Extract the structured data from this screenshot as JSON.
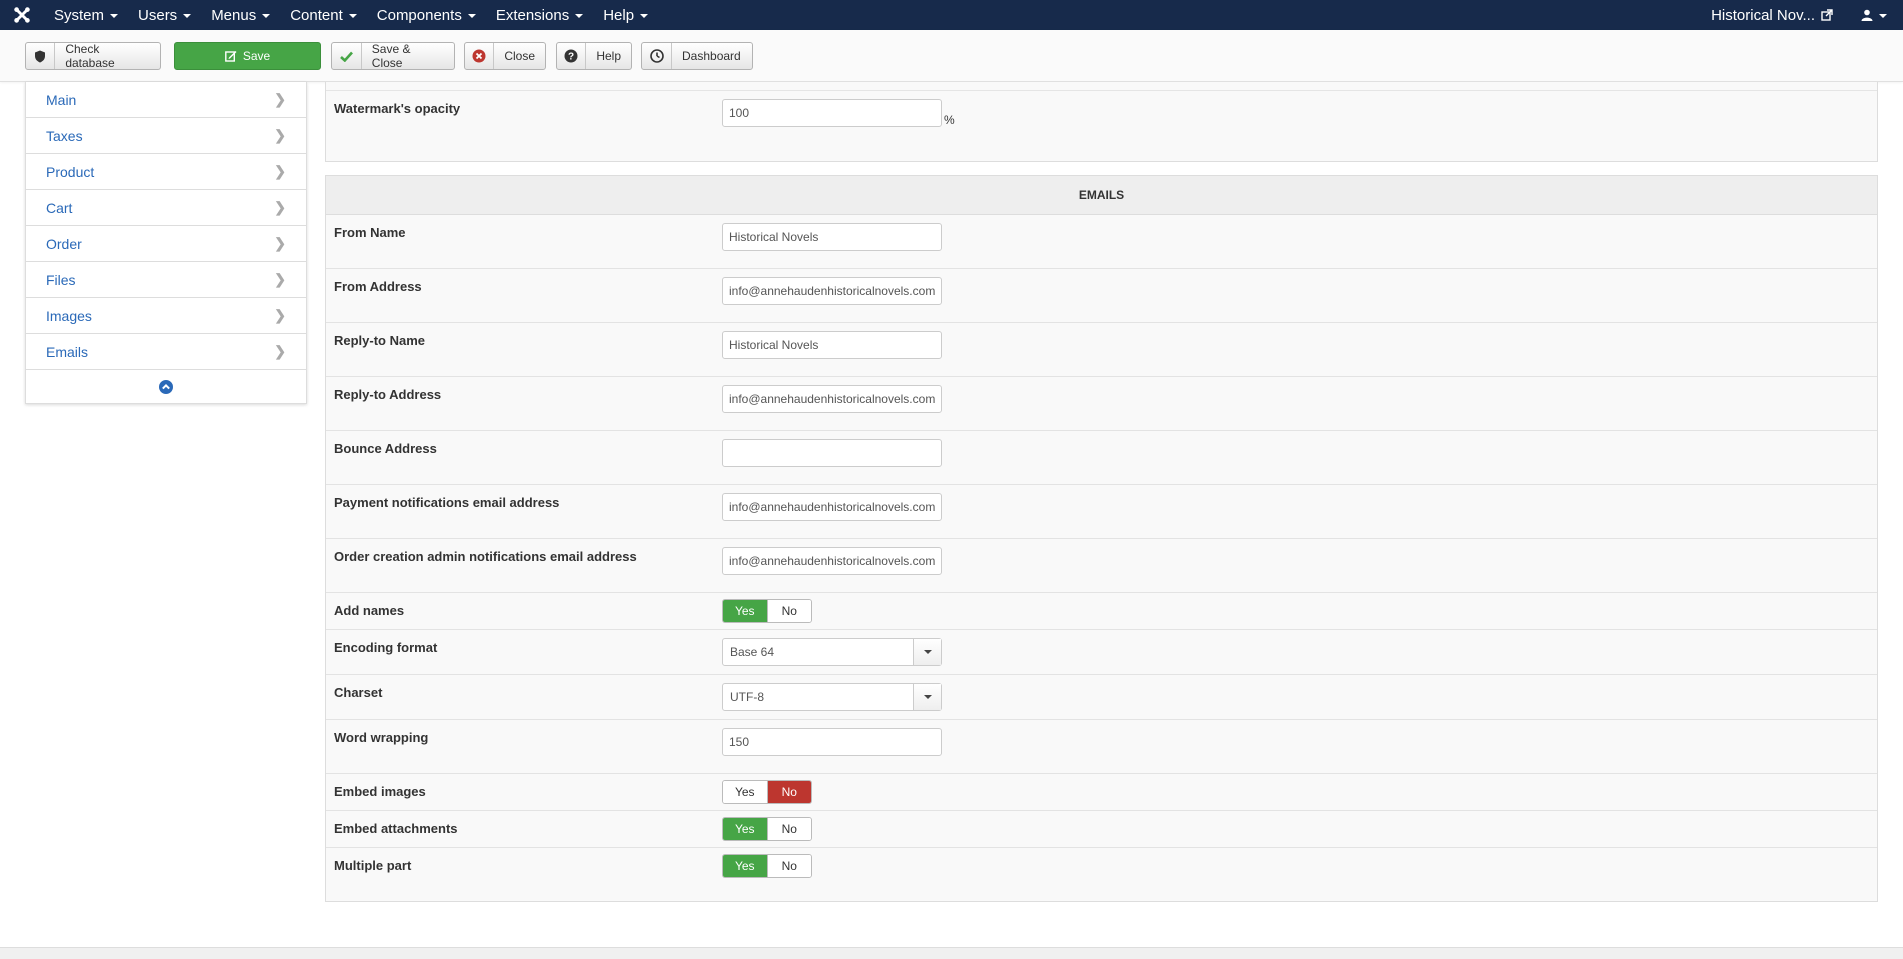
{
  "navbar": {
    "logo_icon": "joomla-logo-icon",
    "menus": [
      "System",
      "Users",
      "Menus",
      "Content",
      "Components",
      "Extensions",
      "Help"
    ],
    "site_name": "Historical Nov...",
    "site_icon": "external-link-icon",
    "user_icon": "user-icon"
  },
  "toolbar": {
    "check_database": "Check database",
    "save": "Save",
    "save_close": "Save & Close",
    "close": "Close",
    "help": "Help",
    "dashboard": "Dashboard"
  },
  "sidebar": {
    "items": [
      "Main",
      "Taxes",
      "Product",
      "Cart",
      "Order",
      "Files",
      "Images",
      "Emails"
    ],
    "collapse_icon": "chevron-up-circle-icon"
  },
  "watermark": {
    "label": "Watermark's opacity",
    "value": "100",
    "unit": "%"
  },
  "emails": {
    "heading": "EMAILS",
    "from_name": {
      "label": "From Name",
      "value": "Historical Novels"
    },
    "from_address": {
      "label": "From Address",
      "value": "info@annehaudenhistoricalnovels.com"
    },
    "reply_to_name": {
      "label": "Reply-to Name",
      "value": "Historical Novels"
    },
    "reply_to_address": {
      "label": "Reply-to Address",
      "value": "info@annehaudenhistoricalnovels.com"
    },
    "bounce_address": {
      "label": "Bounce Address",
      "value": ""
    },
    "payment_notifications": {
      "label": "Payment notifications email address",
      "value": "info@annehaudenhistoricalnovels.com"
    },
    "order_admin_notifications": {
      "label": "Order creation admin notifications email address",
      "value": "info@annehaudenhistoricalnovels.com"
    },
    "add_names": {
      "label": "Add names",
      "yes": "Yes",
      "no": "No",
      "selected": "Yes"
    },
    "encoding_format": {
      "label": "Encoding format",
      "value": "Base 64"
    },
    "charset": {
      "label": "Charset",
      "value": "UTF-8"
    },
    "word_wrapping": {
      "label": "Word wrapping",
      "value": "150"
    },
    "embed_images": {
      "label": "Embed images",
      "yes": "Yes",
      "no": "No",
      "selected": "No"
    },
    "embed_attachments": {
      "label": "Embed attachments",
      "yes": "Yes",
      "no": "No",
      "selected": "Yes"
    },
    "multiple_part": {
      "label": "Multiple part",
      "yes": "Yes",
      "no": "No",
      "selected": "Yes"
    }
  },
  "colors": {
    "navbar_bg": "#172a4b",
    "save_green": "#46a546",
    "toggle_green": "#46a546",
    "toggle_red": "#bd362f",
    "link_blue": "#2a69b8"
  }
}
